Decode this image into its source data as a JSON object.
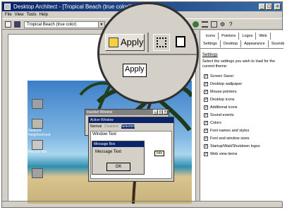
{
  "window": {
    "title": "Desktop Architect - [Tropical Beach (true color)]"
  },
  "menu": {
    "file": "File",
    "view": "View",
    "tools": "Tools",
    "help": "Help"
  },
  "toolbar": {
    "theme_value": "Tropical Beach (true color)"
  },
  "tabs": {
    "row1": [
      "Icons",
      "Pointers",
      "Logos",
      "Web"
    ],
    "row2": [
      "Settings",
      "Desktop",
      "Appearance",
      "Sounds"
    ]
  },
  "settings": {
    "title": "Settings",
    "description": "Select the settings you wish to load for the current theme:",
    "items": [
      {
        "label": "Screen Saver",
        "checked": true
      },
      {
        "label": "Desktop wallpaper",
        "checked": true
      },
      {
        "label": "Mouse pointers",
        "checked": true
      },
      {
        "label": "Desktop icons",
        "checked": true
      },
      {
        "label": "Additional icons",
        "checked": true
      },
      {
        "label": "Sound events",
        "checked": true
      },
      {
        "label": "Colors",
        "checked": true
      },
      {
        "label": "Font names and styles",
        "checked": true
      },
      {
        "label": "Font and window sizes",
        "checked": true
      },
      {
        "label": "Startup/Wait/Shutdown logos",
        "checked": true
      },
      {
        "label": "Web view items",
        "checked": true
      }
    ]
  },
  "preview": {
    "desktop_icons": [
      "Network Neighborhood",
      "Recycle Bin"
    ],
    "inactive_window_title": "Inactive Window",
    "active_window_title": "Active Window",
    "menu_items": [
      "Normal",
      "Disabled",
      "Selected"
    ],
    "window_text": "Window Text",
    "message_box_title": "Message Box",
    "message_text": "Message Text",
    "ok_label": "OK",
    "info_tooltip": "Info"
  },
  "magnifier": {
    "apply_label": "Apply",
    "tooltip": "Apply"
  },
  "colors": {
    "titlebar": "#0a246a",
    "face": "#d4d0c8",
    "selection": "#0a246a"
  }
}
